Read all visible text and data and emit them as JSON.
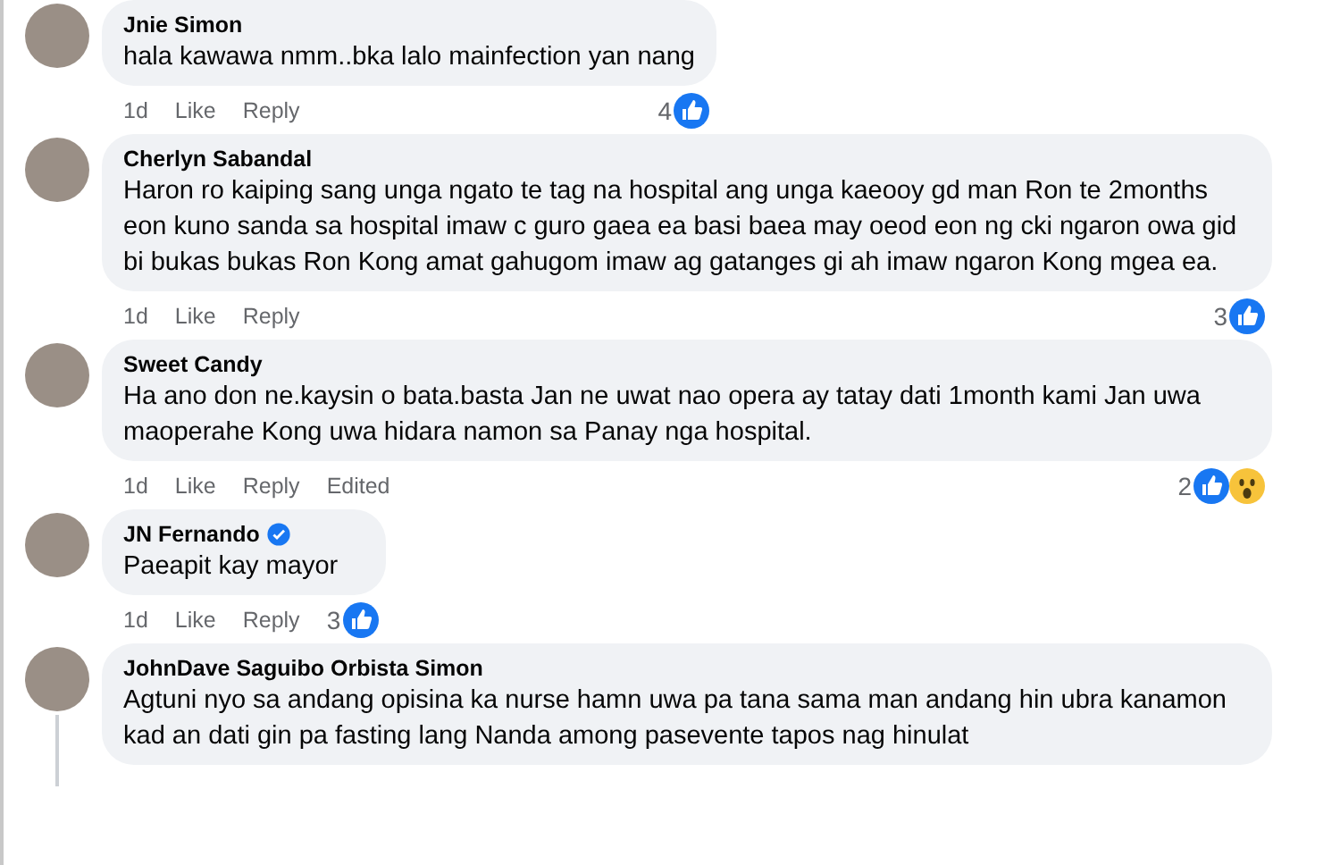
{
  "comments": [
    {
      "author": "Jnie Simon",
      "verified": false,
      "text": "hala kawawa nmm..bka lalo mainfection yan nang",
      "time": "1d",
      "actions": [
        "Like",
        "Reply"
      ],
      "reaction_count": "4",
      "reactions": [
        {
          "kind": "like"
        }
      ],
      "thread": false
    },
    {
      "author": "Cherlyn Sabandal",
      "verified": false,
      "text": "Haron ro kaiping sang unga ngato te tag na hospital ang unga kaeooy gd man Ron te 2months eon kuno sanda sa hospital imaw c guro gaea ea basi baea may oeod eon ng cki ngaron owa gid bi bukas bukas Ron Kong amat gahugom imaw ag gatanges gi ah imaw ngaron Kong mgea ea.",
      "time": "1d",
      "actions": [
        "Like",
        "Reply"
      ],
      "reaction_count": "3",
      "reactions": [
        {
          "kind": "like"
        }
      ],
      "thread": false
    },
    {
      "author": "Sweet Candy",
      "verified": false,
      "text": "Ha ano don ne.kaysin o bata.basta Jan ne uwat nao opera ay tatay dati 1month kami Jan uwa maoperahe Kong uwa hidara namon sa Panay nga hospital.",
      "time": "1d",
      "actions": [
        "Like",
        "Reply"
      ],
      "edited": "Edited",
      "reaction_count": "2",
      "reactions": [
        {
          "kind": "like"
        },
        {
          "kind": "wow"
        }
      ],
      "thread": false
    },
    {
      "author": "JN Fernando",
      "verified": true,
      "text": "Paeapit kay mayor",
      "time": "1d",
      "actions": [
        "Like",
        "Reply"
      ],
      "reaction_count": "3",
      "reactions": [
        {
          "kind": "like"
        }
      ],
      "thread": false
    },
    {
      "author": "JohnDave Saguibo Orbista Simon",
      "verified": false,
      "text": "Agtuni nyo sa andang opisina ka nurse hamn uwa pa tana sama man andang hin ubra kanamon kad an dati gin pa fasting lang Nanda among pasevente tapos nag hinulat",
      "thread": true
    }
  ]
}
